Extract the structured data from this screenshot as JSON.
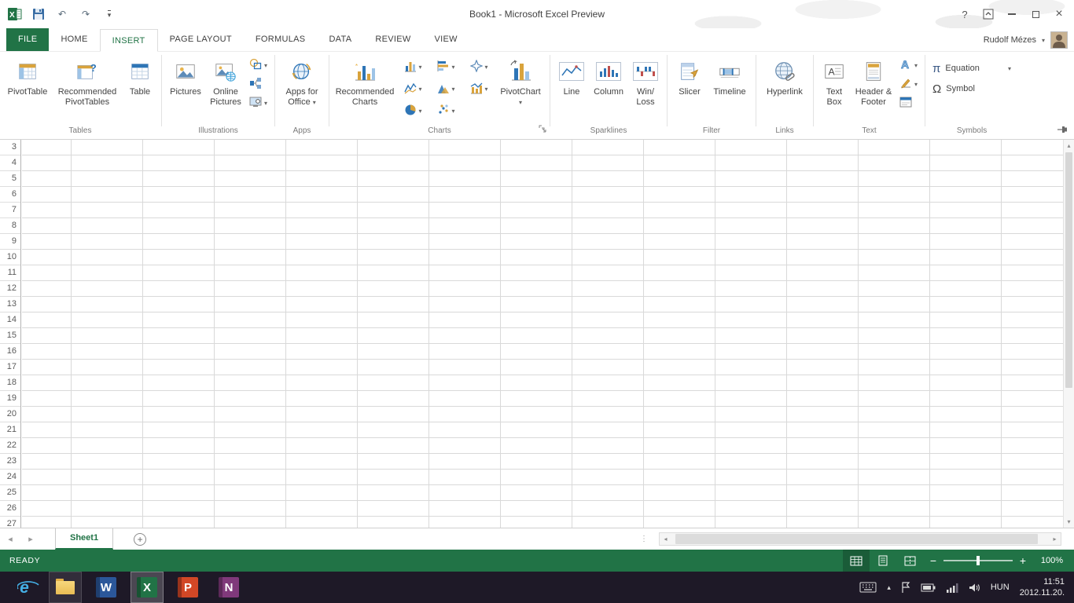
{
  "window": {
    "title": "Book1 - Microsoft Excel Preview",
    "help_label": "?",
    "user_name": "Rudolf Mézes"
  },
  "tabs": {
    "file": "FILE",
    "home": "HOME",
    "insert": "INSERT",
    "page_layout": "PAGE LAYOUT",
    "formulas": "FORMULAS",
    "data": "DATA",
    "review": "REVIEW",
    "view": "VIEW"
  },
  "ribbon": {
    "tables": {
      "label": "Tables",
      "pivottable": "PivotTable",
      "recommended_pivottables": "Recommended PivotTables",
      "table": "Table"
    },
    "illustrations": {
      "label": "Illustrations",
      "pictures": "Pictures",
      "online_pictures": "Online Pictures"
    },
    "apps": {
      "label": "Apps",
      "apps_for_office": "Apps for Office"
    },
    "charts": {
      "label": "Charts",
      "recommended_charts": "Recommended Charts",
      "pivotchart": "PivotChart"
    },
    "sparklines": {
      "label": "Sparklines",
      "line": "Line",
      "column": "Column",
      "win_loss_line1": "Win/",
      "win_loss_line2": "Loss"
    },
    "filter": {
      "label": "Filter",
      "slicer": "Slicer",
      "timeline": "Timeline"
    },
    "links": {
      "label": "Links",
      "hyperlink": "Hyperlink"
    },
    "text_group": {
      "label": "Text",
      "text_box": "Text Box",
      "header_footer": "Header & Footer"
    },
    "symbols": {
      "label": "Symbols",
      "equation": "Equation",
      "symbol": "Symbol",
      "pi": "π",
      "omega": "Ω"
    }
  },
  "sheet": {
    "row_numbers": [
      3,
      4,
      5,
      6,
      7,
      8,
      9,
      10,
      11,
      12,
      13,
      14,
      15,
      16,
      17,
      18,
      19,
      20,
      21,
      22,
      23,
      24,
      25,
      26,
      27
    ]
  },
  "sheet_tabs": {
    "active_tab": "Sheet1"
  },
  "status_bar": {
    "mode": "READY",
    "zoom_level": "100%"
  },
  "taskbar": {
    "language": "HUN",
    "time": "11:51",
    "date": "2012.11.20.",
    "ie_letter": "e",
    "app_letters": {
      "word": "W",
      "excel": "X",
      "powerpoint": "P",
      "onenote": "N"
    }
  },
  "icons": {
    "caret_down": "▾",
    "undo": "↶",
    "redo": "↷",
    "nav_left": "◂",
    "nav_right": "▸",
    "scroll_up": "▴",
    "scroll_down": "▾",
    "dots": "⋮",
    "plus": "+",
    "chevron_up": "▴",
    "close": "×"
  },
  "colors": {
    "excel_green": "#217346",
    "accent_blue": "#2e75b6",
    "accent_gold": "#d9a33c"
  }
}
